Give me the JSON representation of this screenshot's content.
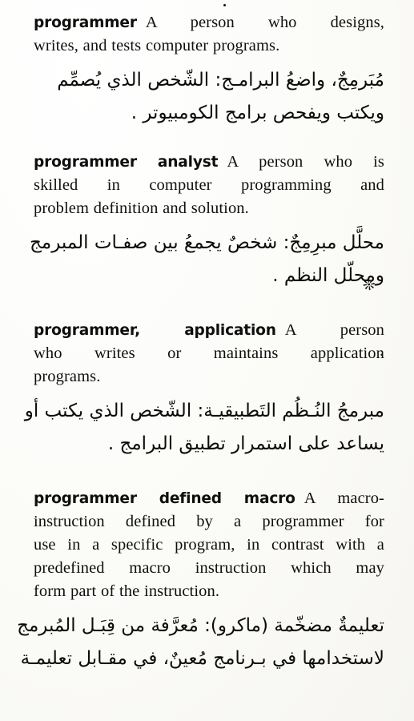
{
  "page": {
    "type": "bilingual-dictionary-page",
    "language_primary": "English",
    "language_secondary": "Arabic",
    "entry_count": 4
  },
  "entries": [
    {
      "headword": "programmer",
      "english_lines": [
        "A person who designs,",
        "writes, and tests computer programs."
      ],
      "english_definition": "A person who designs, writes, and tests computer programs.",
      "arabic_lines": [
        "مُبَرمِجٌ، واضعُ البرامـج: الشّخص الذي يُصمِّم",
        "ويكتب ويفحص برامج الكومبيوتر ."
      ]
    },
    {
      "headword": "programmer analyst",
      "english_lines": [
        "A person who is",
        "skilled in computer programming and",
        "problem definition and solution."
      ],
      "english_definition": "A person who is skilled in computer programming and problem definition and solution.",
      "arabic_lines": [
        "محلَّل مبرِمِجٌ: شخصٌ يجمعُ بين صفـات المبرمج",
        "ومحلّل النظم ."
      ]
    },
    {
      "headword": "programmer, application",
      "english_lines": [
        "A person",
        "who writes or maintains application",
        "programs."
      ],
      "english_definition": "A person who writes or maintains application programs.",
      "arabic_lines": [
        "مبرمجُ النُـظُم التَطبيقيـة: الشّخص الذي يكتب أو",
        "يساعد على استمرار تطبيق البرامج ."
      ]
    },
    {
      "headword": "programmer defined macro",
      "english_lines": [
        "A macro-",
        "instruction defined by a programmer for",
        "use in a specific program, in contrast with a",
        "predefined macro instruction which may",
        "form part of the instruction."
      ],
      "english_definition": "A macro-instruction defined by a programmer for use in a specific program, in contrast with a predefined macro instruction which may form part of the instruction.",
      "arabic_lines": [
        "تعليمةٌ مضخّمة (ماكرو): مُعرَّفة من قِبَـل المُبرمج",
        "لاستخدامها في بـرنامج مُعينٌ، في مقـابل تعليمـة"
      ]
    }
  ],
  "artifacts": {
    "stray_period_label": ".",
    "smudge_label": "ink-smudge"
  }
}
